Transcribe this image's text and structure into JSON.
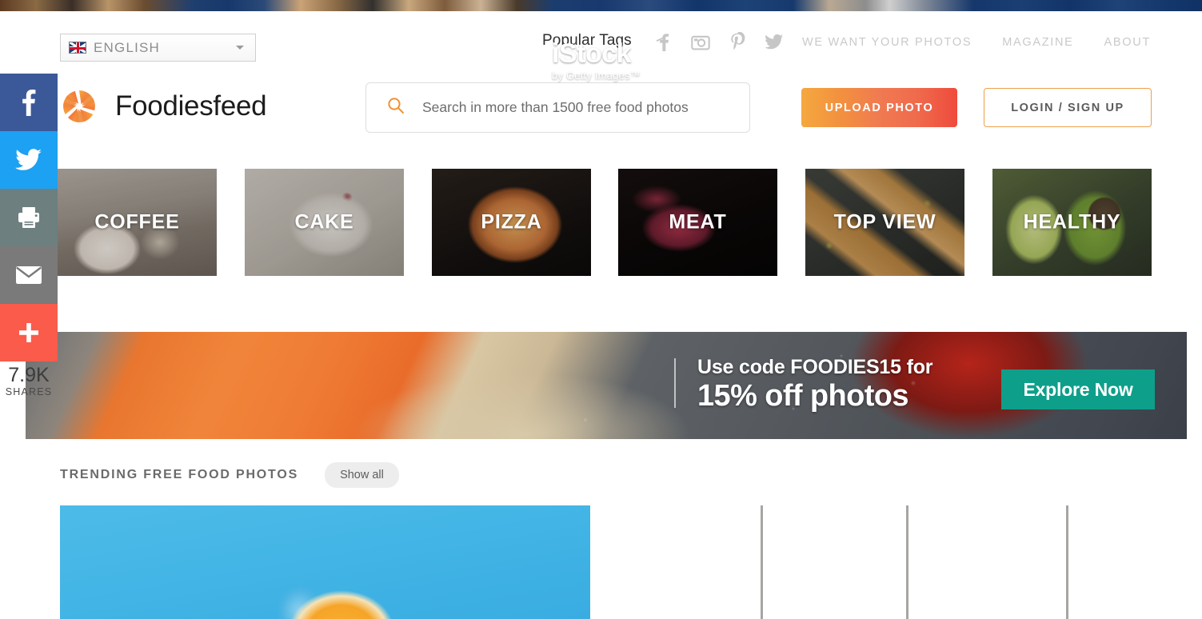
{
  "site": {
    "brand_name": "Foodiesfeed",
    "logo_icon": "aperture-icon"
  },
  "language_selector": {
    "label": "ENGLISH",
    "flag_icon": "uk-flag-icon",
    "caret_icon": "chevron-down-icon"
  },
  "topbar": {
    "popular_tags_label": "Popular Tags",
    "social_icons": [
      {
        "name": "facebook-icon",
        "glyph": "f"
      },
      {
        "name": "instagram-icon",
        "glyph": "instagram"
      },
      {
        "name": "pinterest-icon",
        "glyph": "P"
      },
      {
        "name": "twitter-icon",
        "glyph": "twitter"
      }
    ],
    "links": [
      {
        "label": "WE WANT YOUR PHOTOS"
      },
      {
        "label": "MAGAZINE"
      },
      {
        "label": "ABOUT"
      }
    ]
  },
  "search": {
    "placeholder": "Search in more than 1500 free food photos",
    "value": "",
    "icon": "search-icon"
  },
  "actions": {
    "upload_label": "UPLOAD PHOTO",
    "login_label": "LOGIN / SIGN UP",
    "upload_gradient_from": "#f5a83f",
    "upload_gradient_to": "#ef4b3c",
    "login_border_color": "#f0a04a"
  },
  "share_rail": {
    "count": "7.9K",
    "count_label": "SHARES",
    "buttons": [
      {
        "name": "share-facebook-button",
        "icon": "facebook-icon",
        "color": "#3b5998"
      },
      {
        "name": "share-twitter-button",
        "icon": "twitter-icon",
        "color": "#1da1f2"
      },
      {
        "name": "share-print-button",
        "icon": "printer-icon",
        "color": "#6d7f7f"
      },
      {
        "name": "share-email-button",
        "icon": "envelope-icon",
        "color": "#7a7a7a"
      },
      {
        "name": "share-more-button",
        "icon": "plus-icon",
        "color": "#fb5b4a"
      }
    ]
  },
  "categories": [
    {
      "label": "COFFEE"
    },
    {
      "label": "CAKE"
    },
    {
      "label": "PIZZA"
    },
    {
      "label": "MEAT"
    },
    {
      "label": "TOP VIEW"
    },
    {
      "label": "HEALTHY"
    }
  ],
  "banner": {
    "logo_main": "iStock",
    "logo_sub": "by Getty Images™",
    "line1": "Use code FOODIES15 for",
    "line2": "15% off photos",
    "cta_label": "Explore Now",
    "cta_color": "#0e9f8a"
  },
  "trending": {
    "title": "TRENDING FREE FOOD PHOTOS",
    "show_all_label": "Show all"
  },
  "photos": [
    {
      "name": "photo-card-orange-slice-blue"
    },
    {
      "name": "photo-card-tomatoes-garlic"
    }
  ]
}
